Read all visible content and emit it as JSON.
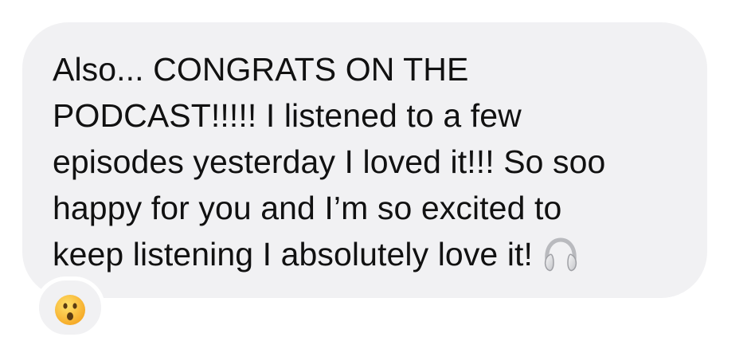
{
  "message": {
    "lines": [
      "Also... CONGRATS ON THE",
      "PODCAST!!!!! I listened to a few",
      "episodes yesterday I loved it!!! So soo",
      "happy for you and I’m so excited to",
      "keep listening I absolutely love it!"
    ],
    "trailing_emoji": "headphones-icon"
  },
  "reaction": {
    "emoji": "hushed-face-icon"
  },
  "colors": {
    "bubble": "#f1f1f3",
    "text": "#111111",
    "page_background": "#ffffff",
    "emoji_yellow": "#fbc02d"
  }
}
